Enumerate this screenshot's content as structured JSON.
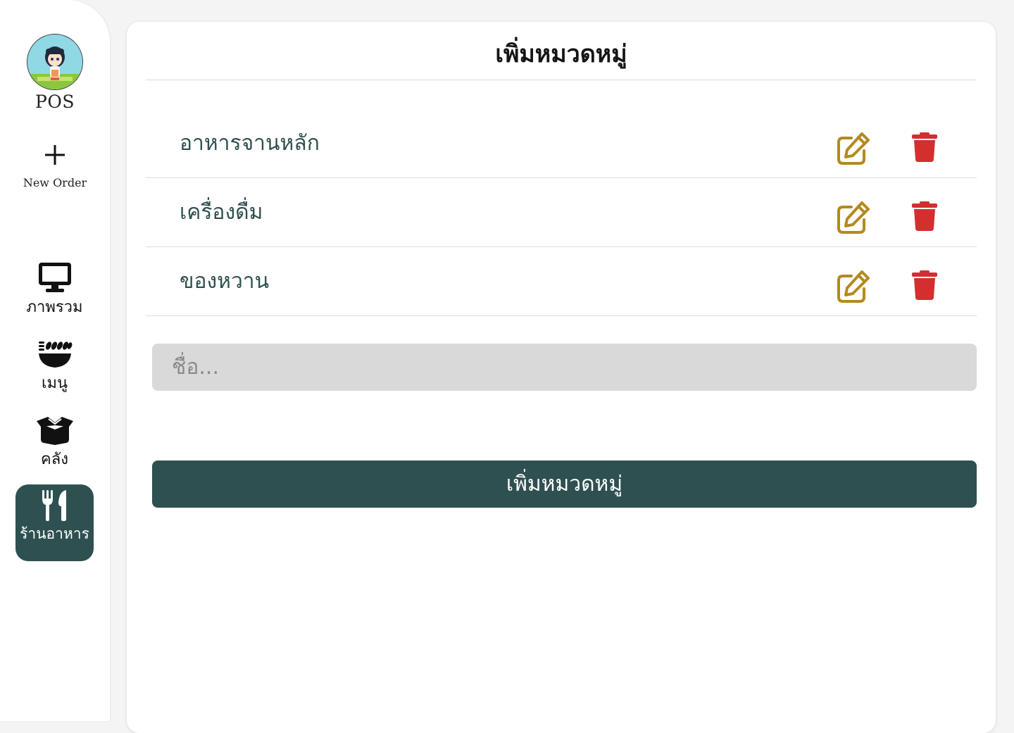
{
  "sidebar": {
    "brand": "POS",
    "new_order_label": "New Order",
    "items": [
      {
        "label": "ภาพรวม",
        "icon": "monitor-icon"
      },
      {
        "label": "เมนู",
        "icon": "food-bowl-icon"
      },
      {
        "label": "คลัง",
        "icon": "box-icon"
      },
      {
        "label": "ร้านอาหาร",
        "icon": "utensils-icon",
        "active": true
      }
    ]
  },
  "main": {
    "title": "เพิ่มหมวดหมู่",
    "categories": [
      {
        "name": "อาหารจานหลัก"
      },
      {
        "name": "เครื่องดื่ม"
      },
      {
        "name": "ของหวาน"
      }
    ],
    "input_placeholder": "ชื่อ...",
    "submit_label": "เพิ่มหมวดหมู่"
  },
  "colors": {
    "accent": "#2f5050",
    "edit_icon": "#b5891f",
    "delete_icon": "#d32f2f",
    "category_text": "#2f4f4f",
    "input_bg": "#d9d9d9"
  }
}
